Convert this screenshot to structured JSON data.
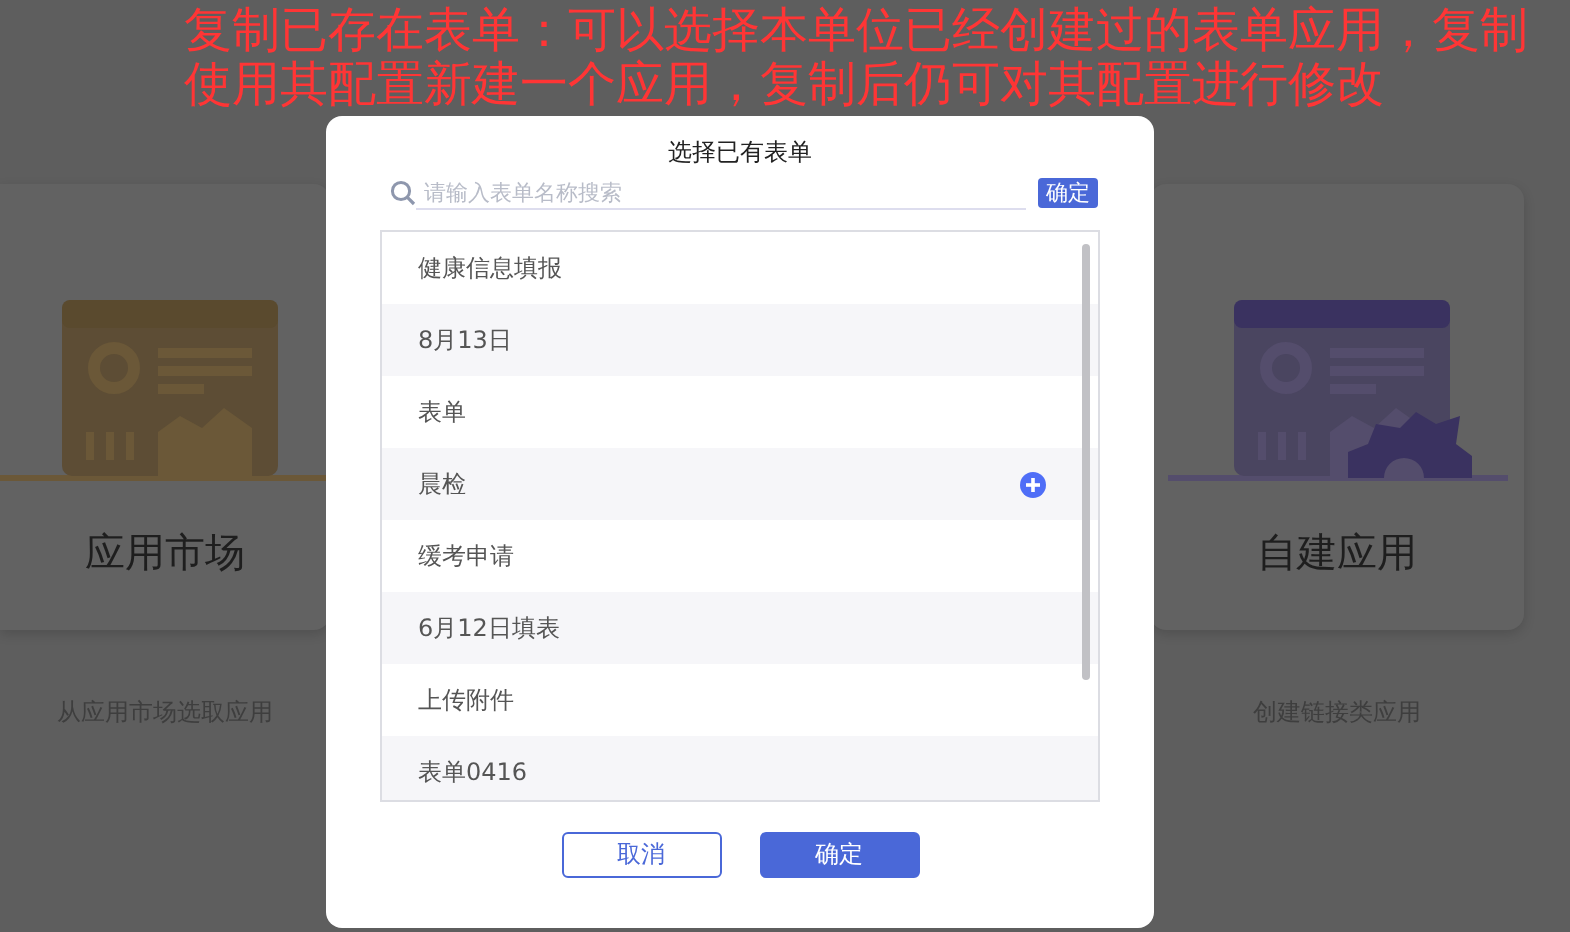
{
  "background_cards": [
    {
      "title": "应用市场",
      "description": "从应用市场选取应用",
      "kind": "market"
    },
    {
      "title": "自建应用",
      "description": "创建链接类应用",
      "kind": "custom"
    }
  ],
  "dialog": {
    "title": "选择已有表单",
    "search": {
      "placeholder": "请输入表单名称搜索",
      "button": "确定"
    },
    "forms": [
      {
        "label": "健康信息填报",
        "hovered": false
      },
      {
        "label": "8月13日",
        "hovered": false
      },
      {
        "label": "表单",
        "hovered": false
      },
      {
        "label": "晨检",
        "hovered": true
      },
      {
        "label": "缓考申请",
        "hovered": false
      },
      {
        "label": "6月12日填表",
        "hovered": false
      },
      {
        "label": "上传附件",
        "hovered": false
      },
      {
        "label": "表单0416",
        "hovered": false
      }
    ],
    "buttons": [
      {
        "label": "取消",
        "kind": "secondary"
      },
      {
        "label": "确定",
        "kind": "primary"
      }
    ]
  },
  "annotation": "复制已存在表单：可以选择本单位已经创建过的表单应用，复制使用其配置新建一个应用，复制后仍可对其配置进行修改"
}
